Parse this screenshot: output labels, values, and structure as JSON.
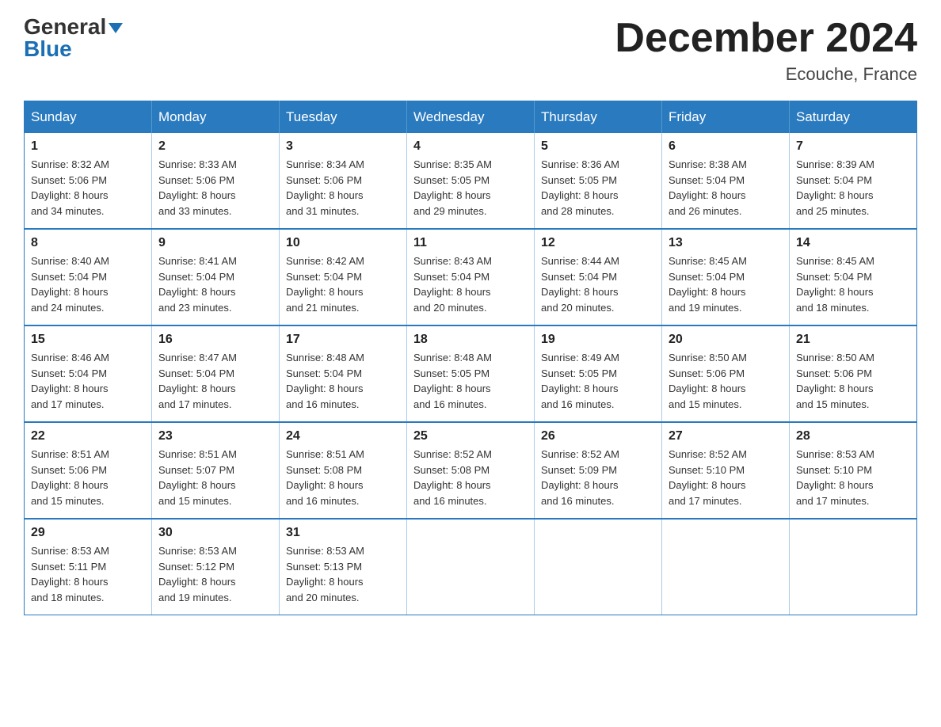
{
  "logo": {
    "part1": "General",
    "part2": "Blue"
  },
  "title": "December 2024",
  "location": "Ecouche, France",
  "weekdays": [
    "Sunday",
    "Monday",
    "Tuesday",
    "Wednesday",
    "Thursday",
    "Friday",
    "Saturday"
  ],
  "weeks": [
    [
      {
        "day": "1",
        "sunrise": "8:32 AM",
        "sunset": "5:06 PM",
        "daylight": "8 hours and 34 minutes."
      },
      {
        "day": "2",
        "sunrise": "8:33 AM",
        "sunset": "5:06 PM",
        "daylight": "8 hours and 33 minutes."
      },
      {
        "day": "3",
        "sunrise": "8:34 AM",
        "sunset": "5:06 PM",
        "daylight": "8 hours and 31 minutes."
      },
      {
        "day": "4",
        "sunrise": "8:35 AM",
        "sunset": "5:05 PM",
        "daylight": "8 hours and 29 minutes."
      },
      {
        "day": "5",
        "sunrise": "8:36 AM",
        "sunset": "5:05 PM",
        "daylight": "8 hours and 28 minutes."
      },
      {
        "day": "6",
        "sunrise": "8:38 AM",
        "sunset": "5:04 PM",
        "daylight": "8 hours and 26 minutes."
      },
      {
        "day": "7",
        "sunrise": "8:39 AM",
        "sunset": "5:04 PM",
        "daylight": "8 hours and 25 minutes."
      }
    ],
    [
      {
        "day": "8",
        "sunrise": "8:40 AM",
        "sunset": "5:04 PM",
        "daylight": "8 hours and 24 minutes."
      },
      {
        "day": "9",
        "sunrise": "8:41 AM",
        "sunset": "5:04 PM",
        "daylight": "8 hours and 23 minutes."
      },
      {
        "day": "10",
        "sunrise": "8:42 AM",
        "sunset": "5:04 PM",
        "daylight": "8 hours and 21 minutes."
      },
      {
        "day": "11",
        "sunrise": "8:43 AM",
        "sunset": "5:04 PM",
        "daylight": "8 hours and 20 minutes."
      },
      {
        "day": "12",
        "sunrise": "8:44 AM",
        "sunset": "5:04 PM",
        "daylight": "8 hours and 20 minutes."
      },
      {
        "day": "13",
        "sunrise": "8:45 AM",
        "sunset": "5:04 PM",
        "daylight": "8 hours and 19 minutes."
      },
      {
        "day": "14",
        "sunrise": "8:45 AM",
        "sunset": "5:04 PM",
        "daylight": "8 hours and 18 minutes."
      }
    ],
    [
      {
        "day": "15",
        "sunrise": "8:46 AM",
        "sunset": "5:04 PM",
        "daylight": "8 hours and 17 minutes."
      },
      {
        "day": "16",
        "sunrise": "8:47 AM",
        "sunset": "5:04 PM",
        "daylight": "8 hours and 17 minutes."
      },
      {
        "day": "17",
        "sunrise": "8:48 AM",
        "sunset": "5:04 PM",
        "daylight": "8 hours and 16 minutes."
      },
      {
        "day": "18",
        "sunrise": "8:48 AM",
        "sunset": "5:05 PM",
        "daylight": "8 hours and 16 minutes."
      },
      {
        "day": "19",
        "sunrise": "8:49 AM",
        "sunset": "5:05 PM",
        "daylight": "8 hours and 16 minutes."
      },
      {
        "day": "20",
        "sunrise": "8:50 AM",
        "sunset": "5:06 PM",
        "daylight": "8 hours and 15 minutes."
      },
      {
        "day": "21",
        "sunrise": "8:50 AM",
        "sunset": "5:06 PM",
        "daylight": "8 hours and 15 minutes."
      }
    ],
    [
      {
        "day": "22",
        "sunrise": "8:51 AM",
        "sunset": "5:06 PM",
        "daylight": "8 hours and 15 minutes."
      },
      {
        "day": "23",
        "sunrise": "8:51 AM",
        "sunset": "5:07 PM",
        "daylight": "8 hours and 15 minutes."
      },
      {
        "day": "24",
        "sunrise": "8:51 AM",
        "sunset": "5:08 PM",
        "daylight": "8 hours and 16 minutes."
      },
      {
        "day": "25",
        "sunrise": "8:52 AM",
        "sunset": "5:08 PM",
        "daylight": "8 hours and 16 minutes."
      },
      {
        "day": "26",
        "sunrise": "8:52 AM",
        "sunset": "5:09 PM",
        "daylight": "8 hours and 16 minutes."
      },
      {
        "day": "27",
        "sunrise": "8:52 AM",
        "sunset": "5:10 PM",
        "daylight": "8 hours and 17 minutes."
      },
      {
        "day": "28",
        "sunrise": "8:53 AM",
        "sunset": "5:10 PM",
        "daylight": "8 hours and 17 minutes."
      }
    ],
    [
      {
        "day": "29",
        "sunrise": "8:53 AM",
        "sunset": "5:11 PM",
        "daylight": "8 hours and 18 minutes."
      },
      {
        "day": "30",
        "sunrise": "8:53 AM",
        "sunset": "5:12 PM",
        "daylight": "8 hours and 19 minutes."
      },
      {
        "day": "31",
        "sunrise": "8:53 AM",
        "sunset": "5:13 PM",
        "daylight": "8 hours and 20 minutes."
      },
      null,
      null,
      null,
      null
    ]
  ],
  "labels": {
    "sunrise": "Sunrise:",
    "sunset": "Sunset:",
    "daylight": "Daylight:"
  }
}
